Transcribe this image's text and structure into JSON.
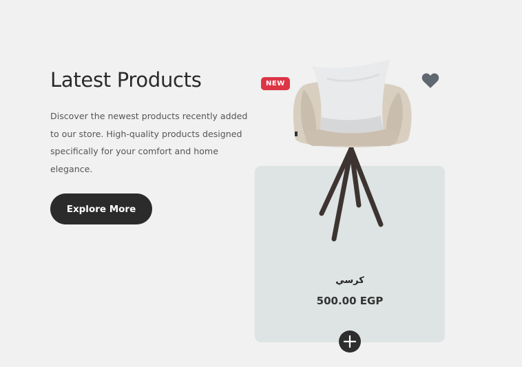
{
  "section": {
    "title": "Latest Products",
    "description": "Discover the newest products recently added to our store. High-quality products designed specifically for your comfort and home elegance.",
    "explore_label": "Explore More"
  },
  "product": {
    "badge": "NEW",
    "name": "كرسي",
    "price": "500.00 EGP",
    "image_icon": "armchair-image",
    "wishlist_icon": "heart-icon",
    "add_icon": "plus-icon"
  },
  "colors": {
    "background": "#f0f1f0",
    "card": "#dde4e3",
    "badge": "#dc3545",
    "button": "#2b2b2b",
    "heart": "#5f6770"
  }
}
